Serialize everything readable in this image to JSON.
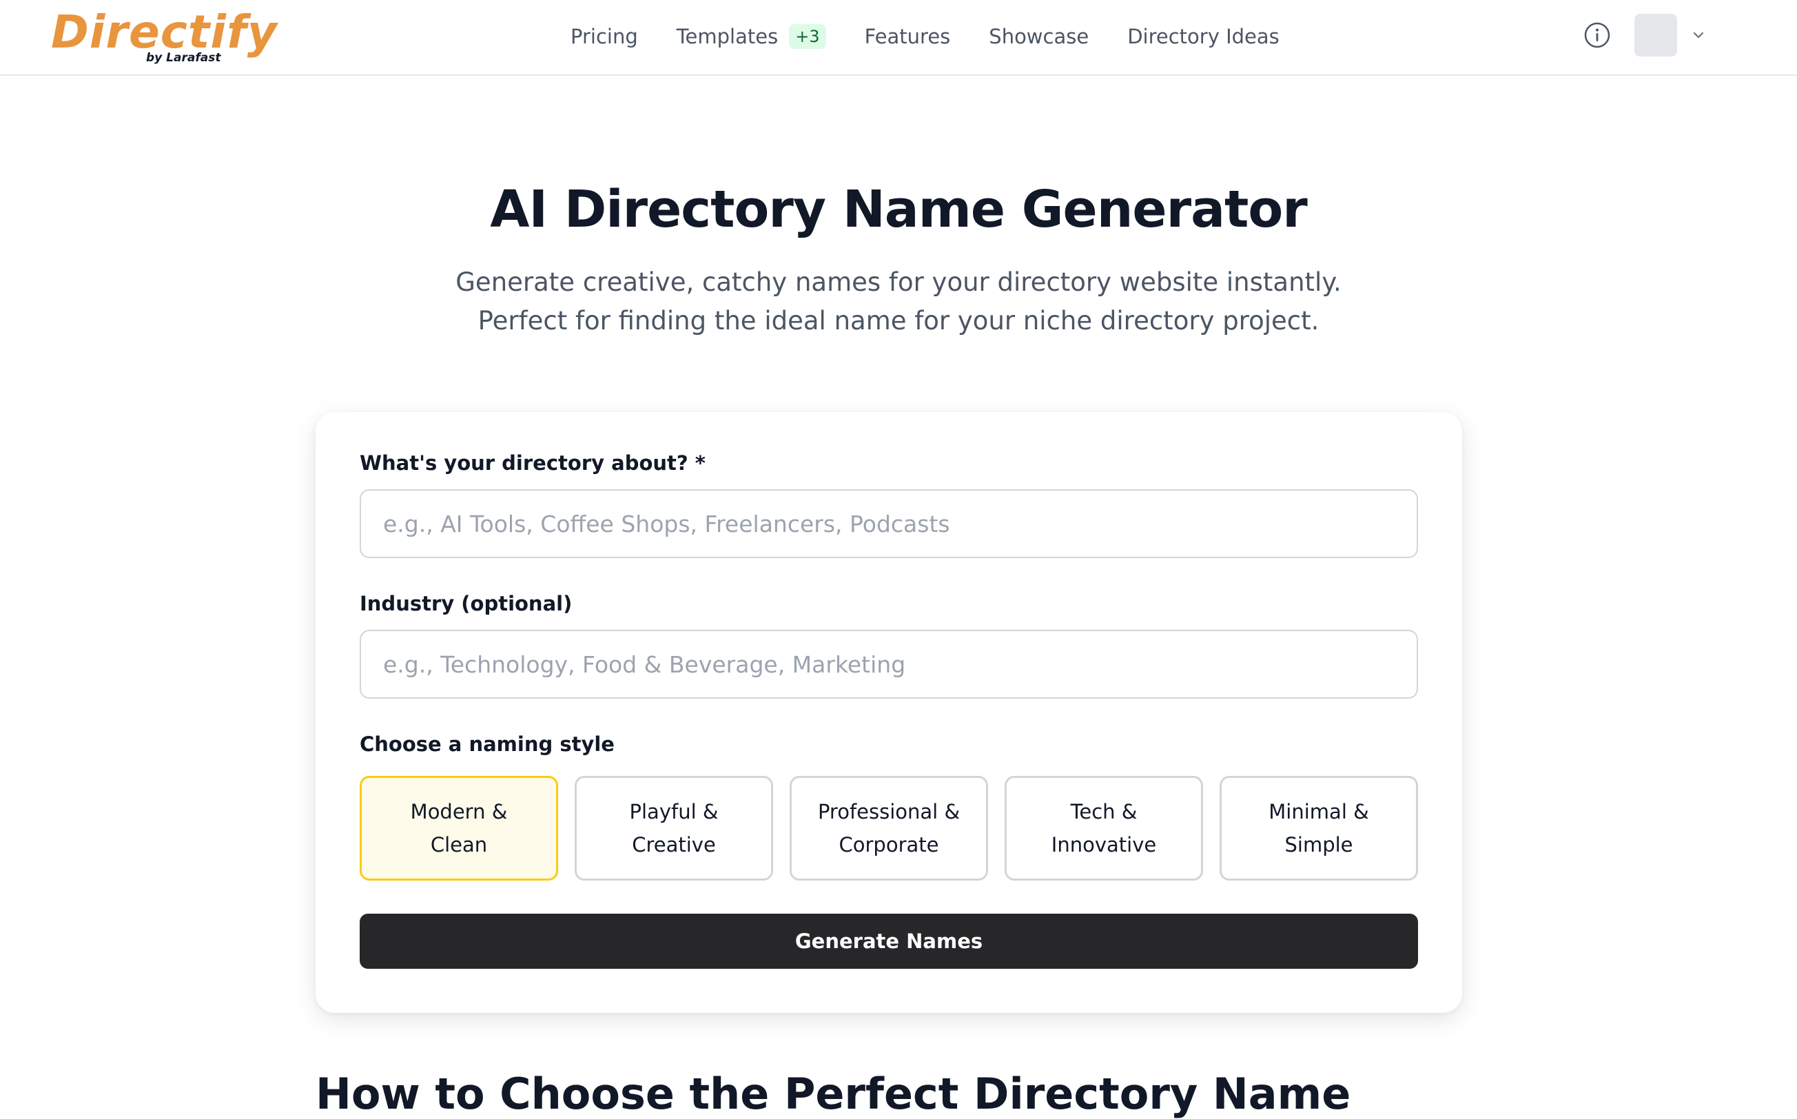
{
  "header": {
    "logo": {
      "name": "Directify",
      "byline": "by Larafast",
      "color": "#e8953e"
    },
    "nav": [
      {
        "label": "Pricing"
      },
      {
        "label": "Templates",
        "badge": "+3"
      },
      {
        "label": "Features"
      },
      {
        "label": "Showcase"
      },
      {
        "label": "Directory Ideas"
      }
    ],
    "icons": {
      "info": "info-icon",
      "user": "avatar",
      "menu": "chevron-down-icon"
    }
  },
  "hero": {
    "title": "AI Directory Name Generator",
    "subtitle_line1": "Generate creative, catchy names for your directory website instantly.",
    "subtitle_line2": "Perfect for finding the ideal name for your niche directory project."
  },
  "form": {
    "topic_label": "What's your directory about? *",
    "topic_placeholder": "e.g., AI Tools, Coffee Shops, Freelancers, Podcasts",
    "topic_value": "",
    "industry_label": "Industry (optional)",
    "industry_placeholder": "e.g., Technology, Food & Beverage, Marketing",
    "industry_value": "",
    "style_label": "Choose a naming style",
    "styles": [
      {
        "line1": "Modern &",
        "line2": "Clean",
        "selected": true
      },
      {
        "line1": "Playful &",
        "line2": "Creative",
        "selected": false
      },
      {
        "line1": "Professional &",
        "line2": "Corporate",
        "selected": false
      },
      {
        "line1": "Tech &",
        "line2": "Innovative",
        "selected": false
      },
      {
        "line1": "Minimal &",
        "line2": "Simple",
        "selected": false
      }
    ],
    "generate_label": "Generate Names",
    "colors": {
      "selected_bg": "#fefbea",
      "selected_border": "#facc15",
      "button_bg": "#27272a"
    }
  },
  "next_section": {
    "heading": "How to Choose the Perfect Directory Name"
  }
}
